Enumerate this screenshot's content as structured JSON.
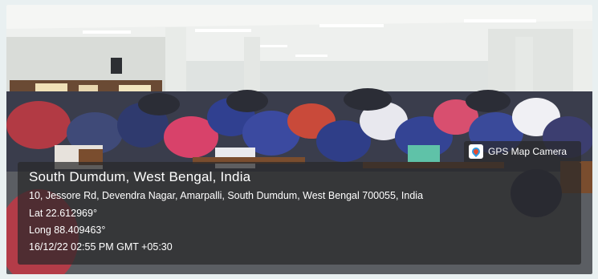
{
  "badge": {
    "label": "GPS Map Camera",
    "icon": "map-pin-icon"
  },
  "location": {
    "title": "South Dumdum, West Bengal, India",
    "address": "10, Jessore Rd, Devendra Nagar, Amarpalli, South Dumdum, West Bengal 700055, India",
    "lat": "Lat 22.612969°",
    "long": "Long 88.409463°",
    "datetime": "16/12/22 02:55 PM GMT +05:30"
  },
  "colors": {
    "overlay": "#28282a",
    "ceiling": "#eef0ee",
    "floor": "#5b5e63"
  }
}
